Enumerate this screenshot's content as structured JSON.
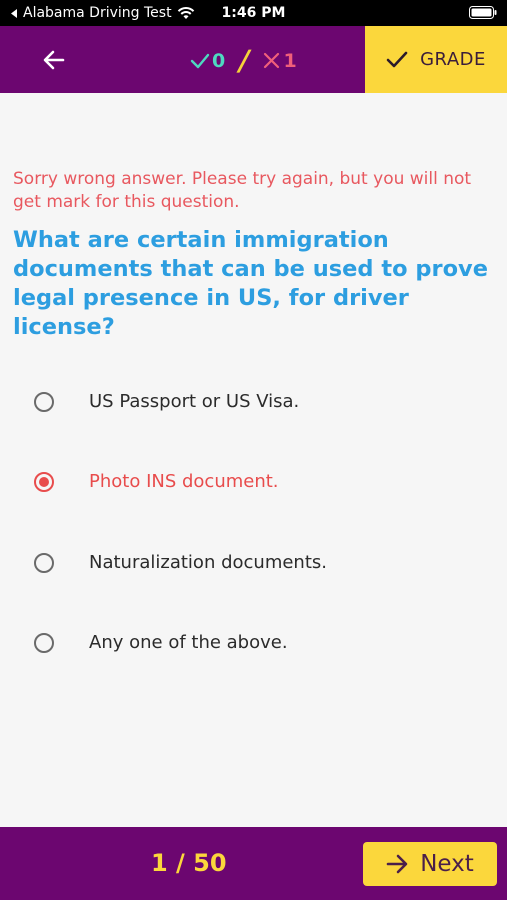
{
  "status_bar": {
    "back_app": "Alabama Driving Test",
    "time": "1:46 PM"
  },
  "header": {
    "correct_count": "0",
    "wrong_count": "1",
    "grade_label": "GRADE"
  },
  "feedback": "Sorry wrong answer. Please try again, but you will not get mark for this question.",
  "question": "What are certain immigration documents that can be used to prove legal presence in US, for driver license?",
  "options": [
    {
      "label": "US Passport or US Visa.",
      "selected": false
    },
    {
      "label": "Photo INS document.",
      "selected": true
    },
    {
      "label": "Naturalization documents.",
      "selected": false
    },
    {
      "label": "Any one of the above.",
      "selected": false
    }
  ],
  "footer": {
    "progress": "1 / 50",
    "next_label": "Next"
  },
  "colors": {
    "bar": "#6c0670",
    "accent": "#fbd73c",
    "correct": "#4ed9c0",
    "wrong": "#f0607a",
    "question": "#2d9ee0",
    "error": "#e8585f"
  }
}
